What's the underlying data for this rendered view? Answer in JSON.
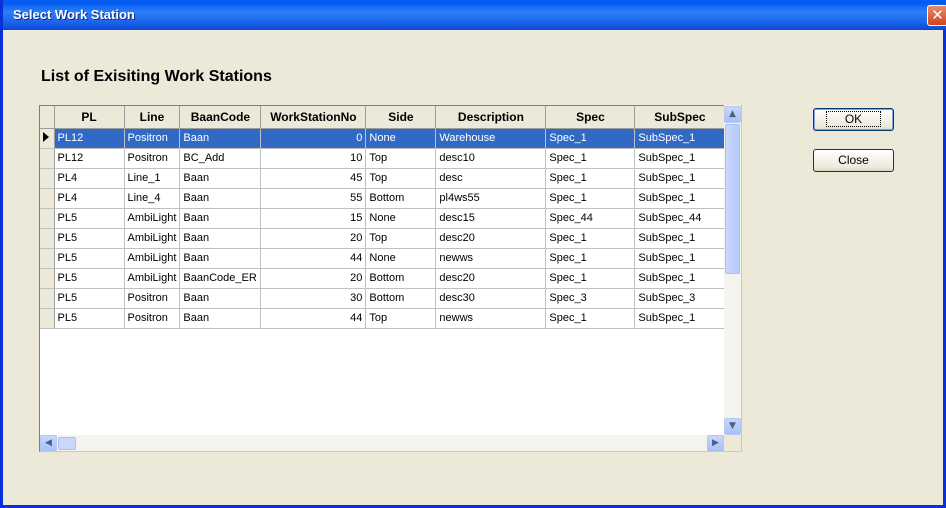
{
  "window": {
    "title": "Select Work Station",
    "close_glyph": "✕"
  },
  "heading": "List of Exisiting Work Stations",
  "table": {
    "columns": [
      "PL",
      "Line",
      "BaanCode",
      "WorkStationNo",
      "Side",
      "Description",
      "Spec",
      "SubSpec"
    ],
    "selected_row": 0,
    "rows": [
      [
        "PL12",
        "Positron",
        "Baan",
        "0",
        "None",
        "Warehouse",
        "Spec_1",
        "SubSpec_1"
      ],
      [
        "PL12",
        "Positron",
        "BC_Add",
        "10",
        "Top",
        "desc10",
        "Spec_1",
        "SubSpec_1"
      ],
      [
        "PL4",
        "Line_1",
        "Baan",
        "45",
        "Top",
        "desc",
        "Spec_1",
        "SubSpec_1"
      ],
      [
        "PL4",
        "Line_4",
        "Baan",
        "55",
        "Bottom",
        "pl4ws55",
        "Spec_1",
        "SubSpec_1"
      ],
      [
        "PL5",
        "AmbiLight",
        "Baan",
        "15",
        "None",
        "desc15",
        "Spec_44",
        "SubSpec_44"
      ],
      [
        "PL5",
        "AmbiLight",
        "Baan",
        "20",
        "Top",
        "desc20",
        "Spec_1",
        "SubSpec_1"
      ],
      [
        "PL5",
        "AmbiLight",
        "Baan",
        "44",
        "None",
        "newws",
        "Spec_1",
        "SubSpec_1"
      ],
      [
        "PL5",
        "AmbiLight",
        "BaanCode_ER",
        "20",
        "Bottom",
        "desc20",
        "Spec_1",
        "SubSpec_1"
      ],
      [
        "PL5",
        "Positron",
        "Baan",
        "30",
        "Bottom",
        "desc30",
        "Spec_3",
        "SubSpec_3"
      ],
      [
        "PL5",
        "Positron",
        "Baan",
        "44",
        "Top",
        "newws",
        "Spec_1",
        "SubSpec_1"
      ]
    ]
  },
  "buttons": {
    "ok_label": "OK",
    "close_label": "Close"
  },
  "scrollbar": {
    "up_glyph": "▲",
    "down_glyph": "▼",
    "left_glyph": "◀",
    "right_glyph": "▶"
  },
  "colors": {
    "selection": "#316ac5",
    "titlebar": "#0058ee",
    "window_bg": "#ece9d8"
  }
}
